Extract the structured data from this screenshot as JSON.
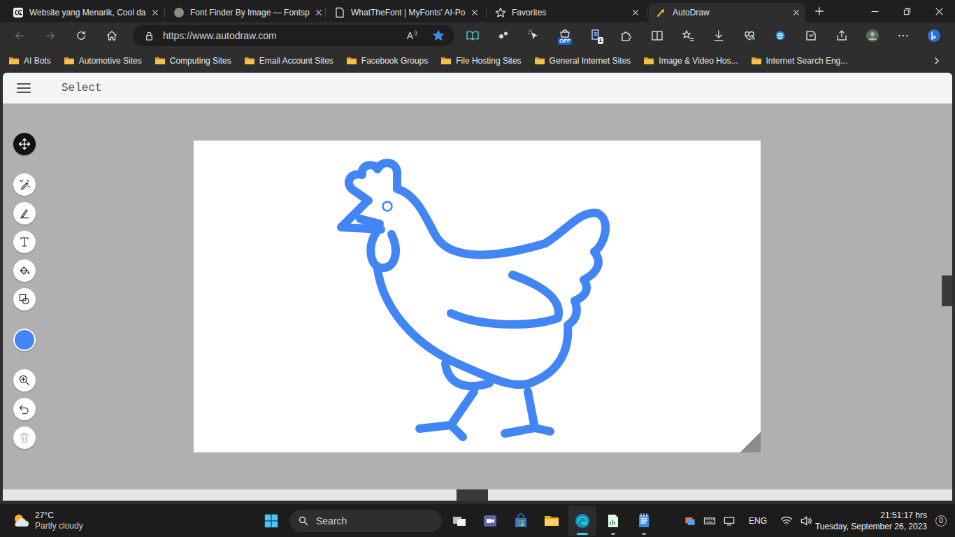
{
  "tabs": [
    {
      "label": "Website yang Menarik, Cool da",
      "selected": false
    },
    {
      "label": "Font Finder By Image — Fontsp",
      "selected": false
    },
    {
      "label": "WhatTheFont | MyFonts' AI-Po",
      "selected": false
    },
    {
      "label": "Favorites",
      "selected": false
    },
    {
      "label": "AutoDraw",
      "selected": true
    }
  ],
  "navigation": {
    "back_enabled": false,
    "forward_enabled": false
  },
  "address_bar": {
    "url": "https://www.autodraw.com",
    "read_aloud": "A",
    "favorite": true
  },
  "badges": [
    "OFF",
    "1"
  ],
  "bookmarks": [
    "AI Bots",
    "Automotive Sites",
    "Computing Sites",
    "Email Account Sites",
    "Facebook Groups",
    "File Hosting Sites",
    "General Internet Sites",
    "Image & Video Hos...",
    "Internet Search Eng..."
  ],
  "app": {
    "mode": "Select"
  },
  "tools": [
    {
      "selected": true,
      "disabled": false
    },
    {
      "selected": false,
      "disabled": false
    },
    {
      "selected": false,
      "disabled": false
    },
    {
      "selected": false,
      "disabled": false
    },
    {
      "selected": false,
      "disabled": false
    },
    {
      "selected": false,
      "disabled": false
    },
    {
      "selected": false,
      "disabled": false
    },
    {
      "selected": false,
      "disabled": false
    },
    {
      "selected": false,
      "disabled": false
    },
    {
      "selected": false,
      "disabled": true
    }
  ],
  "taskbar": {
    "weather": {
      "temperature": "27°C",
      "condition": "Partly cloudy"
    },
    "search": {
      "placeholder": "Search"
    },
    "apps": [
      {
        "active": false,
        "running": false
      },
      {
        "active": false,
        "running": false
      },
      {
        "active": false,
        "running": false
      },
      {
        "active": false,
        "running": false
      },
      {
        "active": true,
        "running": true
      },
      {
        "active": false,
        "running": true
      },
      {
        "active": false,
        "running": true
      }
    ],
    "language": "ENG",
    "clock": {
      "time": "21:51:17 hrs",
      "date": "Tuesday, September 26, 2023"
    },
    "notifications": "0"
  }
}
